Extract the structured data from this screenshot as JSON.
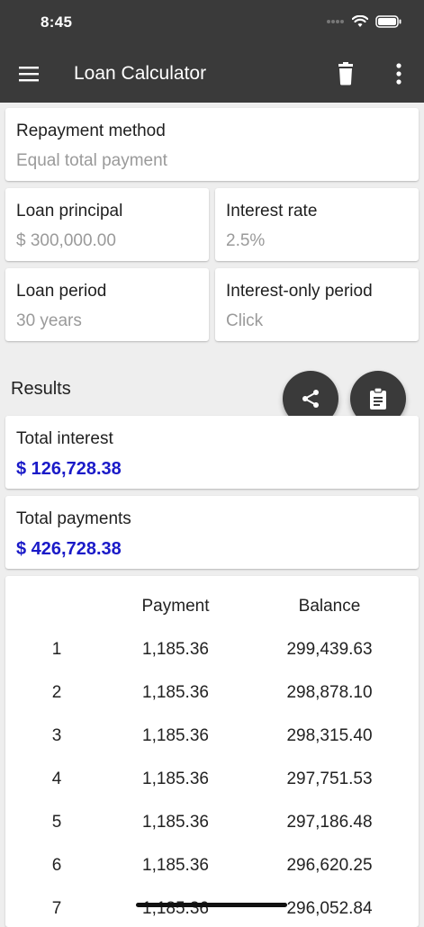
{
  "status_bar": {
    "time": "8:45"
  },
  "app_bar": {
    "title": "Loan Calculator",
    "icons": [
      "menu-icon",
      "trash-icon",
      "more-vert-icon"
    ],
    "background": "#3a3a3a"
  },
  "inputs": {
    "repayment_method": {
      "label": "Repayment method",
      "value": "Equal total payment"
    },
    "loan_principal": {
      "label": "Loan principal",
      "value": "$ 300,000.00"
    },
    "interest_rate": {
      "label": "Interest rate",
      "value": "2.5%"
    },
    "loan_period": {
      "label": "Loan period",
      "value": "30 years"
    },
    "interest_only_period": {
      "label": "Interest-only period",
      "value": "Click"
    }
  },
  "results": {
    "heading": "Results",
    "total_interest": {
      "label": "Total interest",
      "value": "$ 126,728.38"
    },
    "total_payments": {
      "label": "Total payments",
      "value": "$ 426,728.38"
    },
    "accent_color": "#1a1ac8"
  },
  "fabs": {
    "share": "share-icon",
    "copy": "clipboard-icon"
  },
  "schedule": {
    "headers": {
      "period": "",
      "payment": "Payment",
      "balance": "Balance"
    },
    "rows": [
      {
        "n": "1",
        "payment": "1,185.36",
        "balance": "299,439.63"
      },
      {
        "n": "2",
        "payment": "1,185.36",
        "balance": "298,878.10"
      },
      {
        "n": "3",
        "payment": "1,185.36",
        "balance": "298,315.40"
      },
      {
        "n": "4",
        "payment": "1,185.36",
        "balance": "297,751.53"
      },
      {
        "n": "5",
        "payment": "1,185.36",
        "balance": "297,186.48"
      },
      {
        "n": "6",
        "payment": "1,185.36",
        "balance": "296,620.25"
      },
      {
        "n": "7",
        "payment": "1,185.36",
        "balance": "296,052.84"
      }
    ]
  }
}
